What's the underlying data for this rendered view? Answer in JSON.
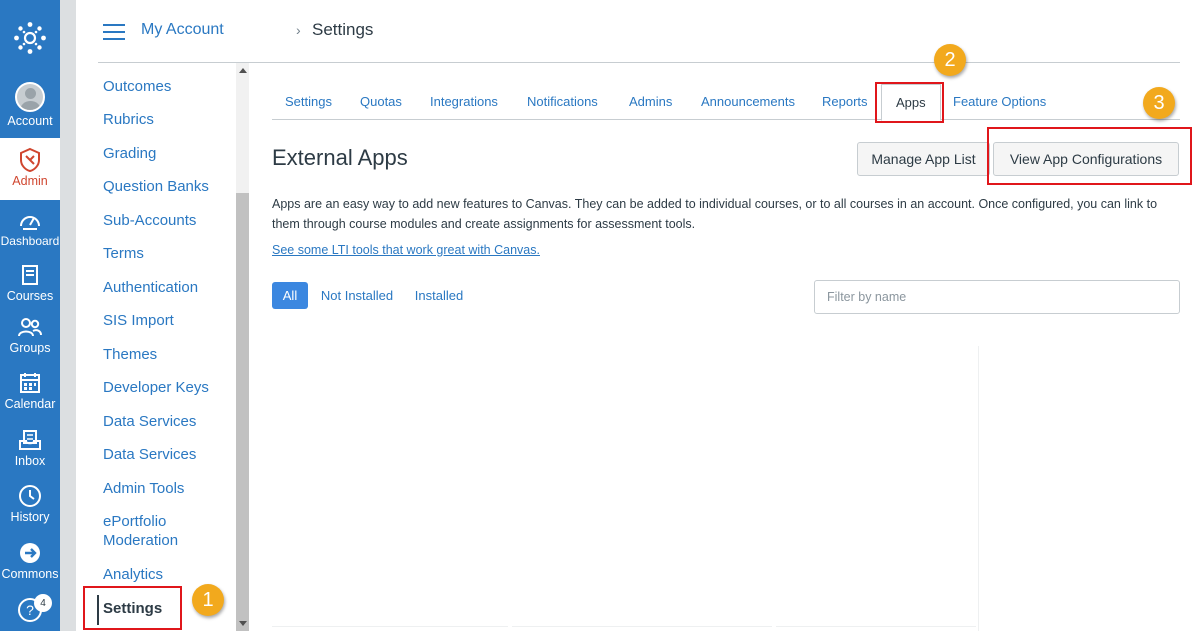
{
  "global_nav": {
    "items": [
      {
        "label": "Account",
        "icon": "avatar-icon"
      },
      {
        "label": "Admin",
        "icon": "shield-icon"
      },
      {
        "label": "Dashboard",
        "icon": "dashboard-icon"
      },
      {
        "label": "Courses",
        "icon": "book-icon"
      },
      {
        "label": "Groups",
        "icon": "groups-icon"
      },
      {
        "label": "Calendar",
        "icon": "calendar-icon"
      },
      {
        "label": "Inbox",
        "icon": "inbox-icon"
      },
      {
        "label": "History",
        "icon": "clock-icon"
      },
      {
        "label": "Commons",
        "icon": "commons-icon"
      }
    ],
    "help_badge": "4",
    "colors": {
      "nav_bg": "#2a78c2",
      "admin_accent": "#d0462f"
    }
  },
  "header": {
    "account": "My Account",
    "page": "Settings"
  },
  "course_nav": {
    "items": [
      {
        "label": "Outcomes"
      },
      {
        "label": "Rubrics"
      },
      {
        "label": "Grading"
      },
      {
        "label": "Question Banks"
      },
      {
        "label": "Sub-Accounts"
      },
      {
        "label": "Terms"
      },
      {
        "label": "Authentication"
      },
      {
        "label": "SIS Import"
      },
      {
        "label": "Themes"
      },
      {
        "label": "Developer Keys"
      },
      {
        "label": "Data Services"
      },
      {
        "label": "Data Services"
      },
      {
        "label": "Admin Tools"
      },
      {
        "label": "ePortfolio Moderation"
      },
      {
        "label": "Analytics"
      },
      {
        "label": "Settings",
        "active": true
      }
    ]
  },
  "tabs": [
    {
      "label": "Settings"
    },
    {
      "label": "Quotas"
    },
    {
      "label": "Integrations"
    },
    {
      "label": "Notifications"
    },
    {
      "label": "Admins"
    },
    {
      "label": "Announcements"
    },
    {
      "label": "Reports"
    },
    {
      "label": "Apps",
      "active": true
    },
    {
      "label": "Feature Options"
    }
  ],
  "external_apps": {
    "title": "External Apps",
    "manage_button": "Manage App List",
    "view_config_button": "View App Configurations",
    "description": "Apps are an easy way to add new features to Canvas. They can be added to individual courses, or to all courses in an account. Once configured, you can link to them through course modules and create assignments for assessment tools.",
    "lti_link": "See some LTI tools that work great with Canvas.",
    "filters": [
      {
        "label": "All",
        "active": true
      },
      {
        "label": "Not Installed"
      },
      {
        "label": "Installed"
      }
    ],
    "filter_placeholder": "Filter by name"
  },
  "annotations": {
    "steps": [
      "1",
      "2",
      "3"
    ],
    "highlight_color": "#e0161b",
    "step_color": "#f2a91d"
  }
}
